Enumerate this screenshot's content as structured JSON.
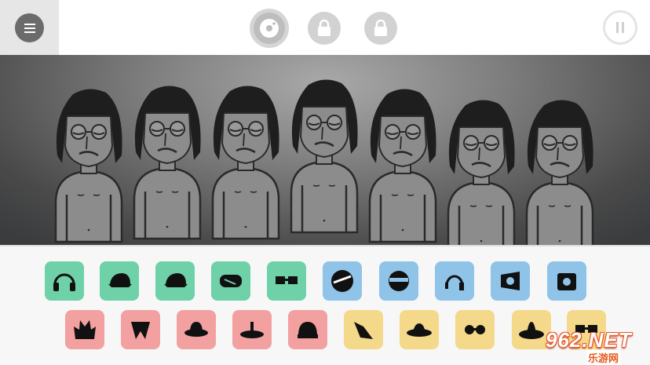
{
  "toolbar": {
    "menu_icon": "hamburger-icon",
    "disc_icon": "vinyl-disc-icon",
    "lock_icon": "padlock-icon",
    "pause_icon": "pause-icon"
  },
  "stage": {
    "performer_count": 7,
    "performer_state": "idle"
  },
  "sound_tray": {
    "row1": [
      {
        "id": "headphones",
        "color": "#6fd1a8",
        "icon": "headphones-icon"
      },
      {
        "id": "cap",
        "color": "#6fd1a8",
        "icon": "cap-icon"
      },
      {
        "id": "cap-side",
        "color": "#6fd1a8",
        "icon": "cap-icon"
      },
      {
        "id": "goggles",
        "color": "#6fd1a8",
        "icon": "goggles-icon"
      },
      {
        "id": "3d-glasses",
        "color": "#6fd1a8",
        "icon": "glasses-icon"
      },
      {
        "id": "visor",
        "color": "#8fc3e8",
        "icon": "visor-icon"
      },
      {
        "id": "round-visor",
        "color": "#8fc3e8",
        "icon": "round-visor-icon"
      },
      {
        "id": "headset",
        "color": "#8fc3e8",
        "icon": "headset-icon"
      },
      {
        "id": "speaker",
        "color": "#8fc3e8",
        "icon": "speaker-icon"
      },
      {
        "id": "boombox",
        "color": "#8fc3e8",
        "icon": "boombox-icon"
      }
    ],
    "row2": [
      {
        "id": "spiky-hat",
        "color": "#f2a0a0",
        "icon": "spiky-hat-icon"
      },
      {
        "id": "scarf",
        "color": "#f2a0a0",
        "icon": "scarf-icon"
      },
      {
        "id": "fedora",
        "color": "#f2a0a0",
        "icon": "fedora-icon"
      },
      {
        "id": "disc-hat",
        "color": "#f2a0a0",
        "icon": "disc-hat-icon"
      },
      {
        "id": "beanie",
        "color": "#f2a0a0",
        "icon": "beanie-icon"
      },
      {
        "id": "feather",
        "color": "#f5d98a",
        "icon": "feather-icon"
      },
      {
        "id": "straw-hat",
        "color": "#f5d98a",
        "icon": "straw-hat-icon"
      },
      {
        "id": "sunglasses",
        "color": "#f5d98a",
        "icon": "sunglasses-icon"
      },
      {
        "id": "sombrero",
        "color": "#f5d98a",
        "icon": "sombrero-icon"
      },
      {
        "id": "top-glasses",
        "color": "#f5d98a",
        "icon": "glasses-icon"
      }
    ]
  },
  "watermark": {
    "text": "962.NET",
    "sub": "乐游网"
  }
}
